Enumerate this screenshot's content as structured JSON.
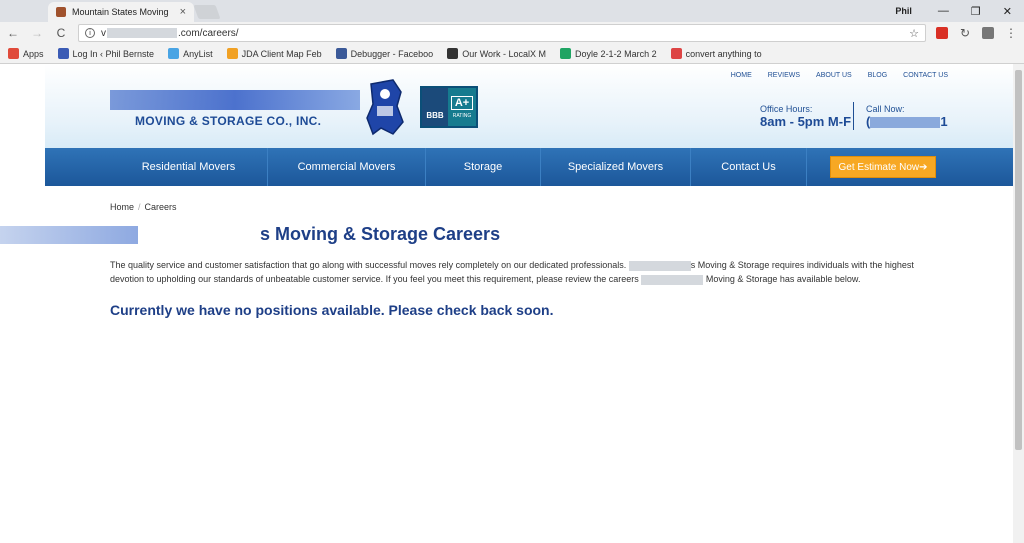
{
  "browser": {
    "tab_title": "Mountain States Moving",
    "tab_close": "×",
    "profile": "Phil",
    "url_prefix": "v",
    "url_suffix": ".com/careers/",
    "bookmarks": [
      {
        "label": "Apps",
        "color": "#e04a3a"
      },
      {
        "label": "Log In ‹ Phil Bernste",
        "color": "#3b5bb5"
      },
      {
        "label": "AnyList",
        "color": "#49a4e4"
      },
      {
        "label": "JDA Client Map Feb",
        "color": "#f1a124"
      },
      {
        "label": "Debugger - Faceboo",
        "color": "#3b5998"
      },
      {
        "label": "Our Work - LocalX M",
        "color": "#333333"
      },
      {
        "label": "Doyle 2-1-2 March 2",
        "color": "#1fa463"
      },
      {
        "label": "convert anything to",
        "color": "#d44"
      }
    ]
  },
  "site": {
    "logo_text": "MOVING & STORAGE CO., INC.",
    "bbb_label": "BBB",
    "bbb_grade": "A+",
    "bbb_rating": "RATING",
    "topnav": [
      "HOME",
      "REVIEWS",
      "ABOUT US",
      "BLOG",
      "CONTACT US"
    ],
    "office_label": "Office Hours:",
    "office_value": "8am - 5pm M-F",
    "call_label": "Call Now:",
    "call_prefix": "(",
    "call_suffix": "1",
    "mainnav": [
      {
        "label": "Residential Movers",
        "width": 158
      },
      {
        "label": "Commercial Movers",
        "width": 158
      },
      {
        "label": "Storage",
        "width": 115
      },
      {
        "label": "Specialized Movers",
        "width": 150
      },
      {
        "label": "Contact Us",
        "width": 116
      }
    ],
    "estimate_label": "Get Estimate Now➔"
  },
  "content": {
    "crumb_home": "Home",
    "crumb_sep": "/",
    "crumb_current": "Careers",
    "title": "s Moving & Storage Careers",
    "para_1": "The quality service and customer satisfaction that go along with successful moves rely completely on our dedicated professionals.",
    "para_2": "s Moving & Storage requires individuals with the highest devotion to upholding our standards of unbeatable customer service. If you feel you meet this requirement, please review the careers",
    "para_3": "Moving & Storage has available below.",
    "notice": "Currently we have no positions available. Please check back soon."
  },
  "colors": {
    "brand_blue": "#1e3f87",
    "nav_blue": "#2f73b7",
    "estimate_orange": "#f7a823"
  }
}
